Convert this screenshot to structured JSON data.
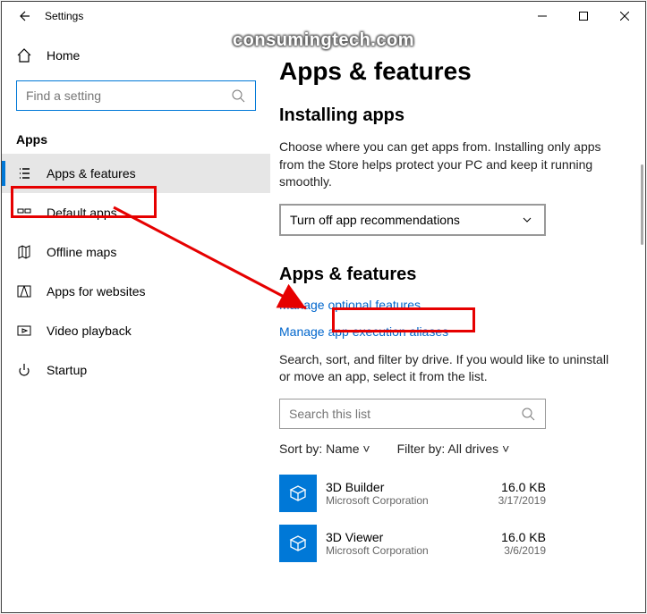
{
  "titlebar": {
    "title": "Settings"
  },
  "sidebar": {
    "home": "Home",
    "search_placeholder": "Find a setting",
    "section": "Apps",
    "items": [
      {
        "label": "Apps & features"
      },
      {
        "label": "Default apps"
      },
      {
        "label": "Offline maps"
      },
      {
        "label": "Apps for websites"
      },
      {
        "label": "Video playback"
      },
      {
        "label": "Startup"
      }
    ]
  },
  "main": {
    "heading": "Apps & features",
    "installing_h": "Installing apps",
    "installing_desc": "Choose where you can get apps from. Installing only apps from the Store helps protect your PC and keep it running smoothly.",
    "dropdown": "Turn off app recommendations",
    "section2_h": "Apps & features",
    "link1": "Manage optional features",
    "link2": "Manage app execution aliases",
    "search_desc": "Search, sort, and filter by drive. If you would like to uninstall or move an app, select it from the list.",
    "search_ph": "Search this list",
    "sort_label": "Sort by:",
    "sort_value": "Name",
    "filter_label": "Filter by:",
    "filter_value": "All drives",
    "apps": [
      {
        "name": "3D Builder",
        "pub": "Microsoft Corporation",
        "size": "16.0 KB",
        "date": "3/17/2019"
      },
      {
        "name": "3D Viewer",
        "pub": "Microsoft Corporation",
        "size": "16.0 KB",
        "date": "3/6/2019"
      }
    ]
  },
  "watermark": "consumingtech.com"
}
